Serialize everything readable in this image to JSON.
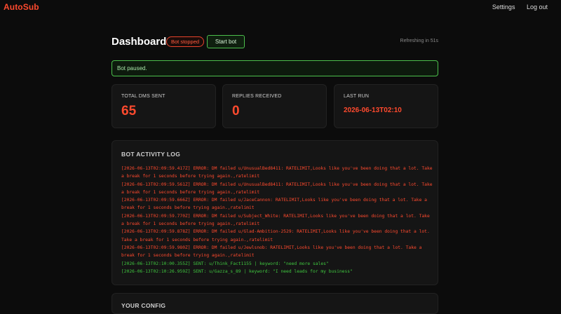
{
  "app": {
    "brand": "AutoSub",
    "nav": [
      "Settings",
      "Log out"
    ]
  },
  "header": {
    "title": "Dashboard",
    "status_badge": "Bot stopped",
    "start_button": "Start bot",
    "refresh_text": "Refreshing in 51s"
  },
  "alert": {
    "message": "Bot paused."
  },
  "stats": [
    {
      "label": "TOTAL DMS SENT",
      "value": "65"
    },
    {
      "label": "REPLIES RECEIVED",
      "value": "0"
    },
    {
      "label": "LAST RUN",
      "value": "2026-06-13T02:10"
    }
  ],
  "log": {
    "heading": "BOT ACTIVITY LOG",
    "lines": [
      {
        "type": "error",
        "text": "[2026-06-13T02:09:59.417Z] ERROR: DM failed u/UnusualBed8411: RATELIMIT,Looks like you've been doing that a lot. Take a break for 1 seconds before trying again.,ratelimit"
      },
      {
        "type": "error",
        "text": "[2026-06-13T02:09:59.561Z] ERROR: DM failed u/UnusualBed8411: RATELIMIT,Looks like you've been doing that a lot. Take a break for 1 seconds before trying again.,ratelimit"
      },
      {
        "type": "error",
        "text": "[2026-06-13T02:09:59.666Z] ERROR: DM failed u/JaceCannon: RATELIMIT,Looks like you've been doing that a lot. Take a break for 1 seconds before trying again.,ratelimit"
      },
      {
        "type": "error",
        "text": "[2026-06-13T02:09:59.770Z] ERROR: DM failed u/Subject_White: RATELIMIT,Looks like you've been doing that a lot. Take a break for 1 seconds before trying again.,ratelimit"
      },
      {
        "type": "error",
        "text": "[2026-06-13T02:09:59.878Z] ERROR: DM failed u/Glad-Ambition-2529: RATELIMIT,Looks like you've been doing that a lot. Take a break for 1 seconds before trying again.,ratelimit"
      },
      {
        "type": "error",
        "text": "[2026-06-13T02:09:59.980Z] ERROR: DM failed u/Jewlsnob: RATELIMIT,Looks like you've been doing that a lot. Take a break for 1 seconds before trying again.,ratelimit"
      },
      {
        "type": "sent",
        "text": "[2026-06-13T02:10:00.355Z] SENT: u/Think_Fact1155 | keyword: \"need more sales\""
      },
      {
        "type": "sent",
        "text": "[2026-06-13T02:10:26.959Z] SENT: u/Gazza_s_89 | keyword: \"I need leads for my business\""
      }
    ]
  },
  "config": {
    "heading": "YOUR CONFIG"
  },
  "colors": {
    "accent": "#ff4a2e",
    "success": "#3fc63f",
    "background": "#0c0c0c",
    "card": "#151515"
  }
}
